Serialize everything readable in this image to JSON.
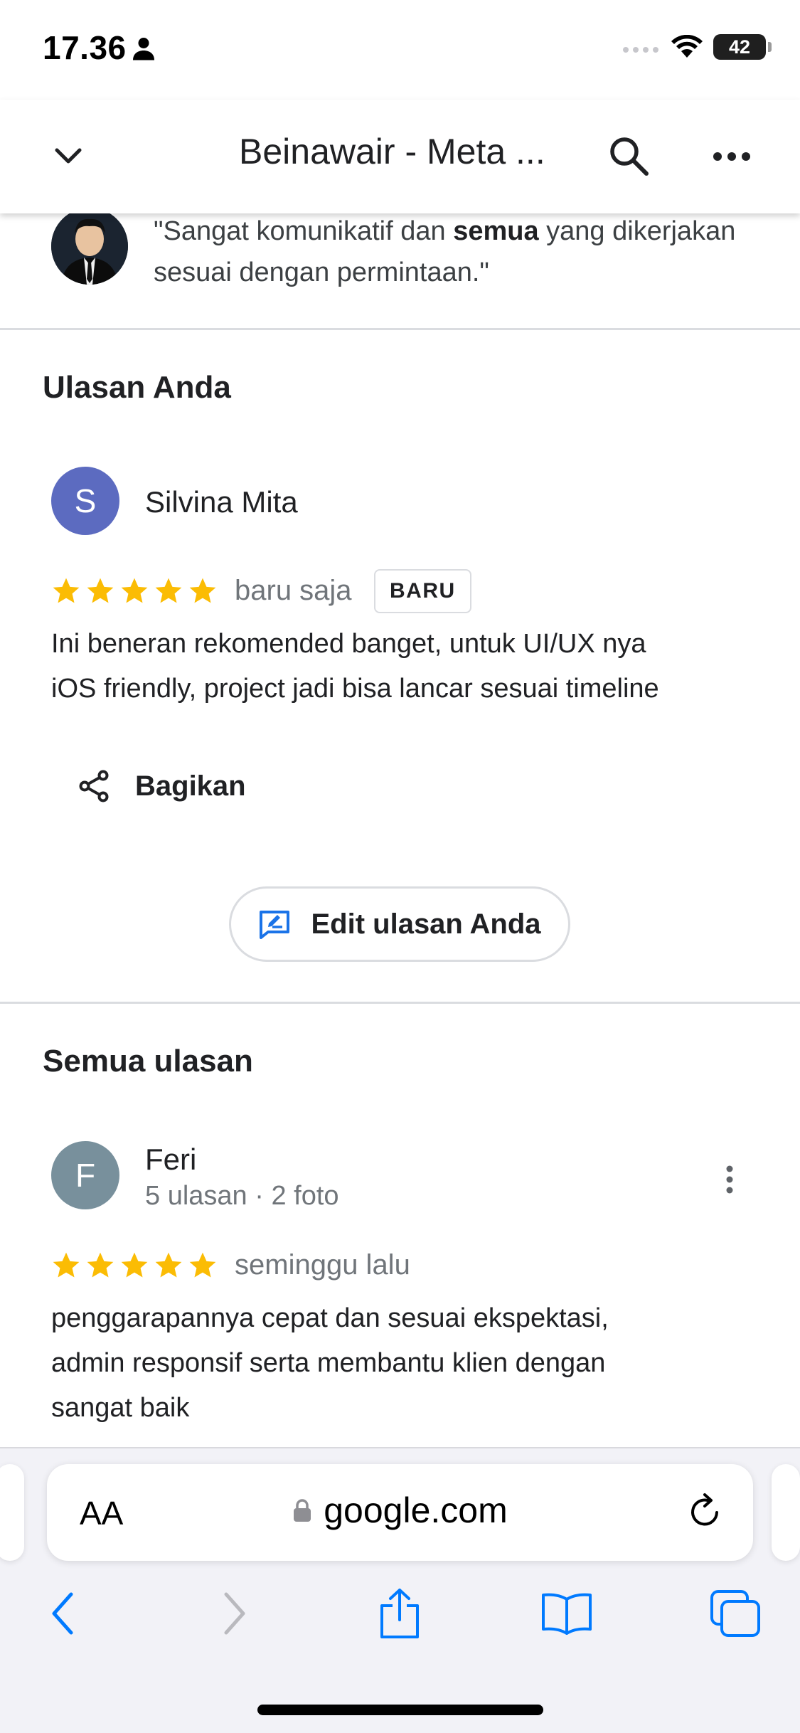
{
  "status_bar": {
    "time": "17.36",
    "battery": "42",
    "icons": [
      "person-icon",
      "signal-icon",
      "wifi-icon",
      "battery-icon"
    ]
  },
  "nav": {
    "title": "Beinawair - Meta ...",
    "icons": [
      "chevron-down-icon",
      "search-icon",
      "more-horizontal-icon"
    ]
  },
  "top_quote": {
    "pre": "\"Sangat komunikatif dan ",
    "bold": "semua",
    "post": " yang dikerjakan sesuai dengan permintaan.\""
  },
  "your_review": {
    "section_title": "Ulasan Anda",
    "avatar_letter": "S",
    "avatar_color": "#5c6bc0",
    "name": "Silvina Mita",
    "stars": 5,
    "time": "baru saja",
    "badge": "BARU",
    "text_line1": "Ini beneran rekomended banget, untuk UI/UX nya",
    "text_line2": "iOS friendly, project jadi bisa lancar sesuai timeline",
    "share_label": "Bagikan",
    "edit_label": "Edit ulasan Anda"
  },
  "all_reviews": {
    "section_title": "Semua ulasan",
    "items": [
      {
        "avatar_letter": "F",
        "avatar_color": "#78909c",
        "name": "Feri",
        "meta": "5 ulasan · 2 foto",
        "stars": 5,
        "time": "seminggu lalu",
        "text_line1": "penggarapannya cepat dan sesuai ekspektasi,",
        "text_line2": "admin responsif serta membantu klien dengan",
        "text_line3": "sangat baik"
      }
    ]
  },
  "browser": {
    "aa_label": "AA",
    "url": "google.com",
    "toolbar_icons": [
      "back-icon",
      "forward-icon",
      "share-icon",
      "bookmarks-icon",
      "tabs-icon"
    ]
  },
  "colors": {
    "star": "#fbbc04",
    "ios_blue": "#007aff",
    "google_blue": "#1a73e8"
  }
}
